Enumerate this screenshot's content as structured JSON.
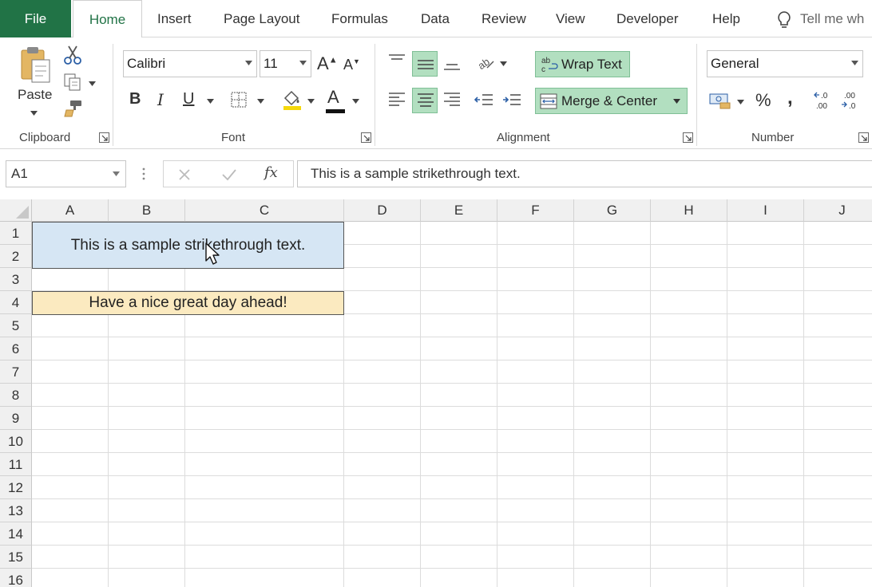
{
  "tabs": {
    "file": "File",
    "home": "Home",
    "insert": "Insert",
    "page_layout": "Page Layout",
    "formulas": "Formulas",
    "data": "Data",
    "review": "Review",
    "view": "View",
    "developer": "Developer",
    "help": "Help",
    "tell_me": "Tell me wh"
  },
  "clipboard": {
    "paste_label": "Paste",
    "group_label": "Clipboard"
  },
  "font": {
    "name": "Calibri",
    "size": "11",
    "bold": "B",
    "italic": "I",
    "underline": "U",
    "grow": "A",
    "shrink": "A",
    "color_glyph": "A",
    "group_label": "Font"
  },
  "alignment": {
    "wrap_text": "Wrap Text",
    "merge_center": "Merge & Center",
    "group_label": "Alignment"
  },
  "number": {
    "format": "General",
    "percent": "%",
    "comma": ",",
    "group_label": "Number"
  },
  "formula_bar": {
    "name_box": "A1",
    "fx": "fx",
    "content": "This is a sample strikethrough text."
  },
  "sheet": {
    "columns": [
      "A",
      "B",
      "C",
      "D",
      "E",
      "F",
      "G",
      "H",
      "I",
      "J"
    ],
    "rows": [
      "1",
      "2",
      "3",
      "4",
      "5",
      "6",
      "7",
      "8",
      "9",
      "10",
      "11",
      "12",
      "13",
      "14",
      "15",
      "16"
    ],
    "cell_a1": "This is a sample strikethrough text.",
    "cell_a4": "Have a nice great day ahead!"
  },
  "colors": {
    "excel_green": "#217346",
    "active_button": "#b2dfc0",
    "a1_fill": "#d6e6f4",
    "a4_fill": "#fbeac0"
  },
  "icons": [
    "scissors-icon",
    "copy-icon",
    "format-painter-icon",
    "lightbulb-icon",
    "borders-icon",
    "fill-color-icon",
    "wrap-text-icon",
    "merge-icon",
    "currency-icon",
    "orientation-icon",
    "mouse-cursor-icon"
  ]
}
